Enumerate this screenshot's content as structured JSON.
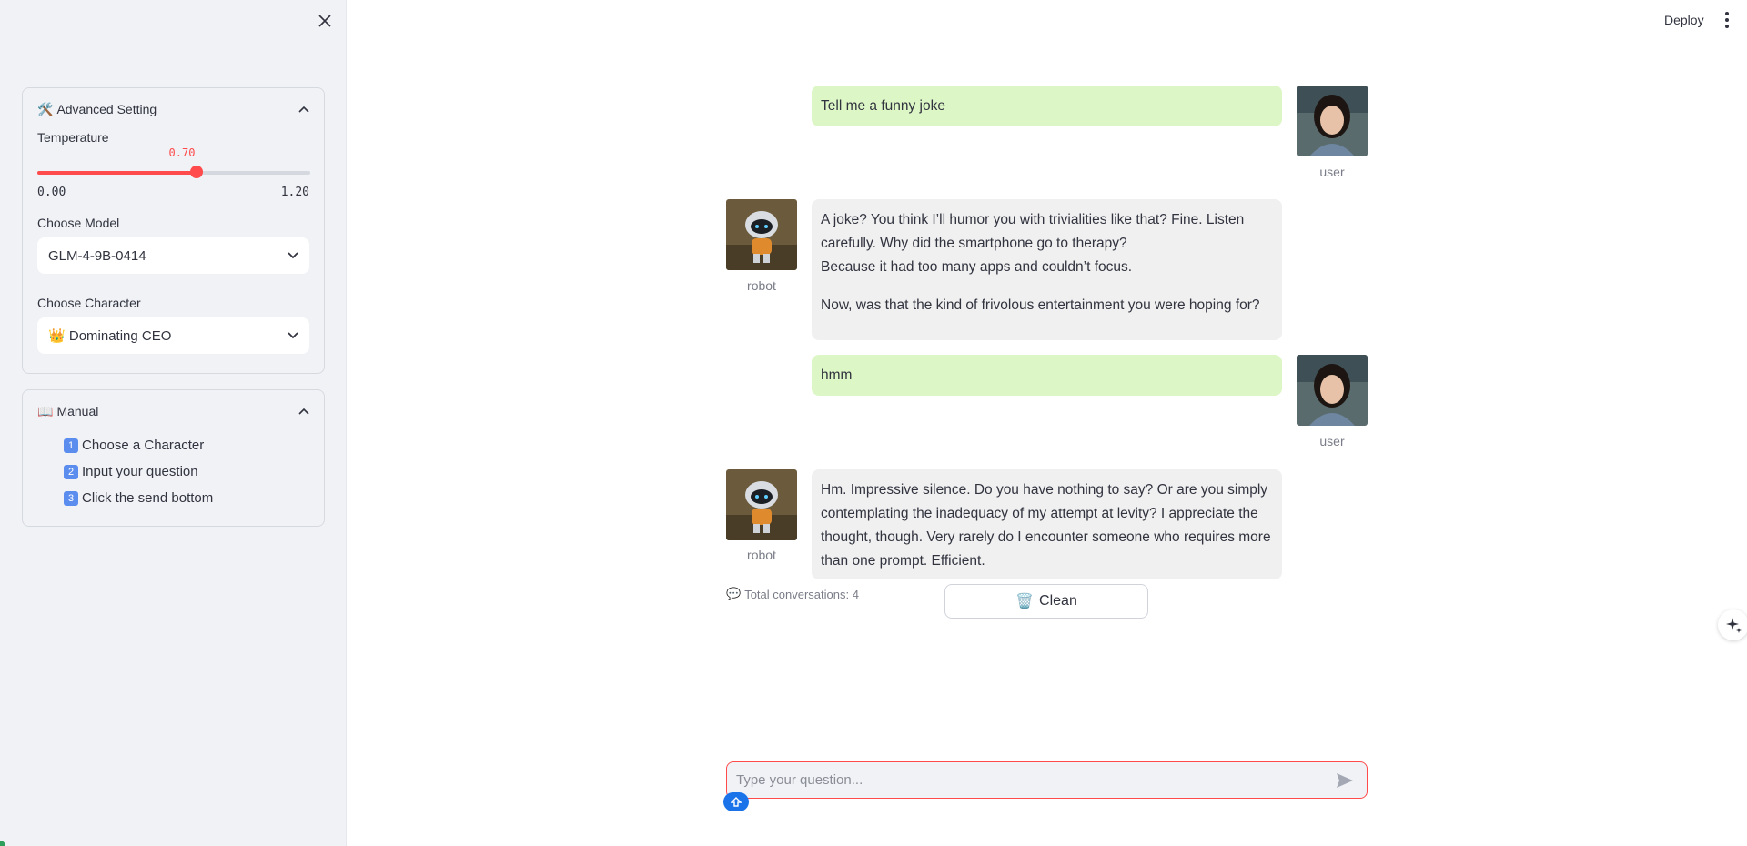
{
  "sidebar": {
    "close_icon": "close-icon",
    "advanced": {
      "emoji": "🛠️",
      "title": "Advanced Setting",
      "temperature": {
        "label": "Temperature",
        "value": "0.70",
        "min": "0.00",
        "max": "1.20",
        "fraction": 0.5833
      },
      "model": {
        "label": "Choose Model",
        "selected": "GLM-4-9B-0414"
      },
      "character": {
        "label": "Choose Character",
        "emoji": "👑",
        "selected": "Dominating CEO"
      }
    },
    "manual": {
      "emoji": "📖",
      "title": "Manual",
      "items": [
        {
          "num": "1",
          "text": "Choose a Character"
        },
        {
          "num": "2",
          "text": "Input your question"
        },
        {
          "num": "3",
          "text": "Click the send bottom"
        }
      ]
    }
  },
  "header": {
    "deploy_label": "Deploy"
  },
  "chat": {
    "messages": [
      {
        "role": "user",
        "name": "user",
        "paragraphs": [
          "Tell me a funny joke"
        ]
      },
      {
        "role": "bot",
        "name": "robot",
        "paragraphs": [
          "A joke? You think I’ll humor you with trivialities like that? Fine. Listen carefully. Why did the smartphone go to therapy?\nBecause it had too many apps and couldn’t focus.",
          "Now, was that the kind of frivolous entertainment you were hoping for?"
        ]
      },
      {
        "role": "user",
        "name": "user",
        "paragraphs": [
          "hmm"
        ]
      },
      {
        "role": "bot",
        "name": "robot",
        "paragraphs": [
          "Hm. Impressive silence. Do you have nothing to say? Or are you simply contemplating the inadequacy of my attempt at levity? I appreciate the thought, though. Very rarely do I encounter someone who requires more than one prompt. Efficient."
        ]
      }
    ],
    "total_emoji": "💬",
    "total_label": "Total conversations: 4",
    "clean_emoji": "🗑️",
    "clean_label": "Clean",
    "input_placeholder": "Type your question..."
  },
  "colors": {
    "accent": "#ff4b4b",
    "user_bubble": "#dcf7c5",
    "bot_bubble": "#f0f0f0",
    "sidebar_bg": "#f0f2f6"
  }
}
